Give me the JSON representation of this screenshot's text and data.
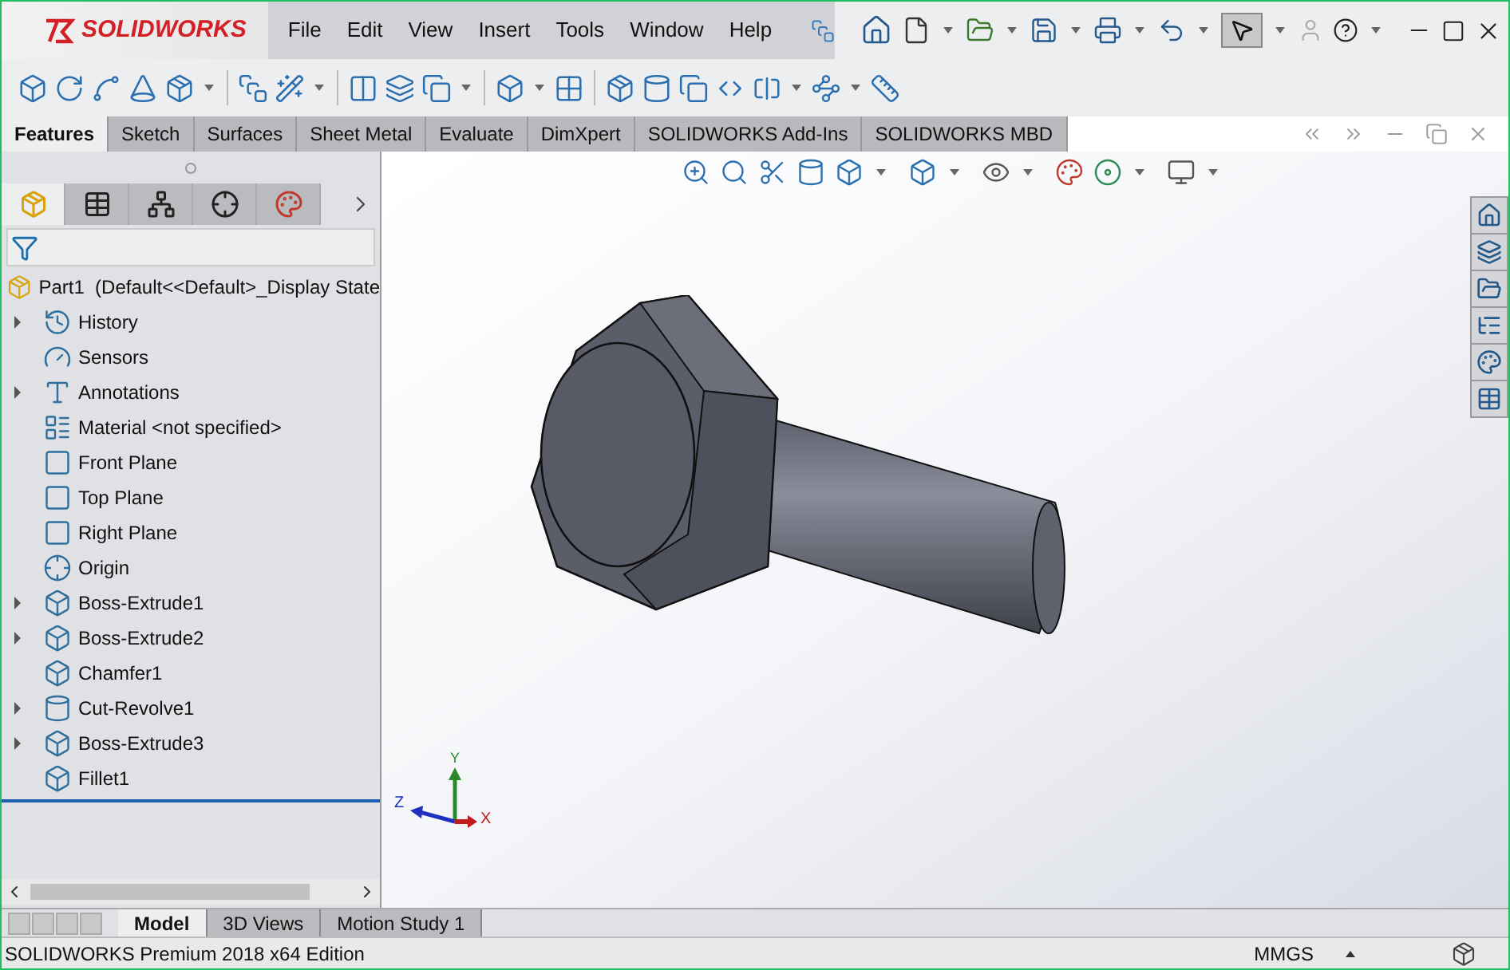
{
  "window": {
    "logo": "SOLIDWORKS",
    "menu": [
      "File",
      "Edit",
      "View",
      "Insert",
      "Tools",
      "Window",
      "Help"
    ]
  },
  "command_tabs": [
    {
      "label": "Features",
      "selected": true
    },
    {
      "label": "Sketch",
      "selected": false
    },
    {
      "label": "Surfaces",
      "selected": false
    },
    {
      "label": "Sheet Metal",
      "selected": false
    },
    {
      "label": "Evaluate",
      "selected": false
    },
    {
      "label": "DimXpert",
      "selected": false
    },
    {
      "label": "SOLIDWORKS Add-Ins",
      "selected": false
    },
    {
      "label": "SOLIDWORKS MBD",
      "selected": false
    }
  ],
  "panel_tabs": [
    {
      "selected": true
    },
    {
      "selected": false
    },
    {
      "selected": false
    },
    {
      "selected": false
    },
    {
      "selected": false
    }
  ],
  "feature_tree": {
    "root": "Part1  (Default<<Default>_Display State",
    "items": [
      {
        "label": "History",
        "expandable": true
      },
      {
        "label": "Sensors",
        "expandable": false
      },
      {
        "label": "Annotations",
        "expandable": true
      },
      {
        "label": "Material <not specified>",
        "expandable": false
      },
      {
        "label": "Front Plane",
        "expandable": false
      },
      {
        "label": "Top Plane",
        "expandable": false
      },
      {
        "label": "Right Plane",
        "expandable": false
      },
      {
        "label": "Origin",
        "expandable": false
      },
      {
        "label": "Boss-Extrude1",
        "expandable": true
      },
      {
        "label": "Boss-Extrude2",
        "expandable": true
      },
      {
        "label": "Chamfer1",
        "expandable": false
      },
      {
        "label": "Cut-Revolve1",
        "expandable": true
      },
      {
        "label": "Boss-Extrude3",
        "expandable": true
      },
      {
        "label": "Fillet1",
        "expandable": false
      }
    ]
  },
  "triad": {
    "y": "Y",
    "z": "Z",
    "x": "X"
  },
  "bottom_tabs": [
    {
      "label": "Model",
      "selected": true
    },
    {
      "label": "3D Views",
      "selected": false
    },
    {
      "label": "Motion Study 1",
      "selected": false
    }
  ],
  "status_bar": {
    "text": "SOLIDWORKS Premium 2018 x64 Edition",
    "units": "MMGS"
  }
}
